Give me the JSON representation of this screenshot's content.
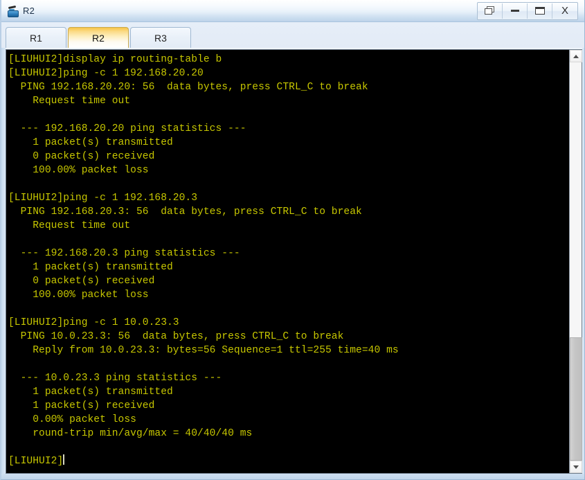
{
  "window": {
    "title": "R2",
    "icon": "router-icon",
    "controls": [
      {
        "name": "restore-button",
        "glyph": "restore",
        "label": ""
      },
      {
        "name": "minimize-button",
        "glyph": "minimize",
        "label": ""
      },
      {
        "name": "maximize-button",
        "glyph": "maximize",
        "label": ""
      },
      {
        "name": "close-button",
        "glyph": "close",
        "label": "X"
      }
    ]
  },
  "tabs": [
    {
      "label": "R1",
      "active": false
    },
    {
      "label": "R2",
      "active": true
    },
    {
      "label": "R3",
      "active": false
    }
  ],
  "terminal": {
    "foreground_color": "#c7c700",
    "background_color": "#000000",
    "prompt": "[LIUHUI2]",
    "lines": [
      "[LIUHUI2]display ip routing-table b",
      "[LIUHUI2]ping -c 1 192.168.20.20",
      "  PING 192.168.20.20: 56  data bytes, press CTRL_C to break",
      "    Request time out",
      "",
      "  --- 192.168.20.20 ping statistics ---",
      "    1 packet(s) transmitted",
      "    0 packet(s) received",
      "    100.00% packet loss",
      "",
      "[LIUHUI2]ping -c 1 192.168.20.3",
      "  PING 192.168.20.3: 56  data bytes, press CTRL_C to break",
      "    Request time out",
      "",
      "  --- 192.168.20.3 ping statistics ---",
      "    1 packet(s) transmitted",
      "    0 packet(s) received",
      "    100.00% packet loss",
      "",
      "[LIUHUI2]ping -c 1 10.0.23.3",
      "  PING 10.0.23.3: 56  data bytes, press CTRL_C to break",
      "    Reply from 10.0.23.3: bytes=56 Sequence=1 ttl=255 time=40 ms",
      "",
      "  --- 10.0.23.3 ping statistics ---",
      "    1 packet(s) transmitted",
      "    1 packet(s) received",
      "    0.00% packet loss",
      "    round-trip min/avg/max = 40/40/40 ms",
      ""
    ],
    "last_line": "[LIUHUI2]"
  },
  "scrollbar": {
    "up_arrow": "scroll-up-icon",
    "down_arrow": "scroll-down-icon",
    "thumb_top_pct": 69,
    "thumb_height_pct": 31
  }
}
